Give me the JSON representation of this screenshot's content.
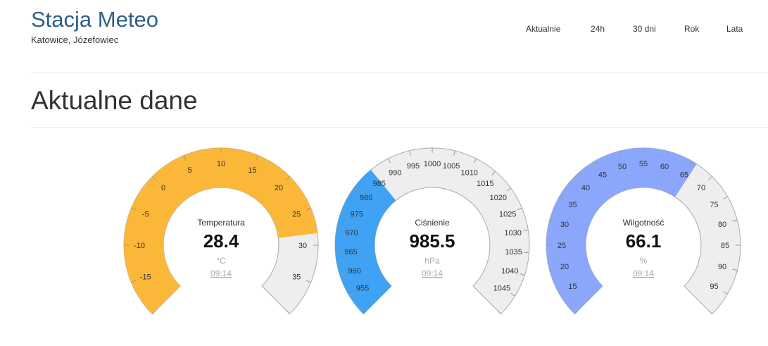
{
  "header": {
    "title": "Stacja Meteo",
    "subtitle": "Katowice, Józefowiec"
  },
  "nav": [
    {
      "label": "Aktualnie"
    },
    {
      "label": "24h"
    },
    {
      "label": "30 dni"
    },
    {
      "label": "Rok"
    },
    {
      "label": "Lata"
    }
  ],
  "page_title": "Aktualne dane",
  "gauges": [
    {
      "name": "Temperatura",
      "value": "28.4",
      "unit": "°C",
      "time": "09:14",
      "value_num": 28.4,
      "range": [
        -20,
        40
      ],
      "color": "#fbb838",
      "ticks": [
        "-15",
        "-10",
        "-5",
        "0",
        "5",
        "10",
        "15",
        "20",
        "25",
        "30",
        "35"
      ],
      "minor_step": 5
    },
    {
      "name": "Ciśnienie",
      "value": "985.5",
      "unit": "hPa",
      "time": "09:14",
      "value_num": 985.5,
      "range": [
        950,
        1050
      ],
      "color": "#3fa2f4",
      "ticks": [
        "955",
        "960",
        "965",
        "970",
        "975",
        "980",
        "985",
        "990",
        "995",
        "1000",
        "1005",
        "1010",
        "1015",
        "1020",
        "1025",
        "1030",
        "1035",
        "1040",
        "1045"
      ],
      "minor_step": 5
    },
    {
      "name": "Wilgotność",
      "value": "66.1",
      "unit": "%",
      "time": "09:14",
      "value_num": 66.1,
      "range": [
        10,
        100
      ],
      "color": "#8ba7fc",
      "ticks": [
        "15",
        "20",
        "25",
        "30",
        "35",
        "40",
        "45",
        "50",
        "55",
        "60",
        "65",
        "70",
        "75",
        "80",
        "85",
        "90",
        "95"
      ],
      "minor_step": 5
    }
  ],
  "colors": {
    "background_arc": "#eeeeee",
    "arc_border": "#aaaaaa",
    "brand": "#2d5f8b"
  }
}
